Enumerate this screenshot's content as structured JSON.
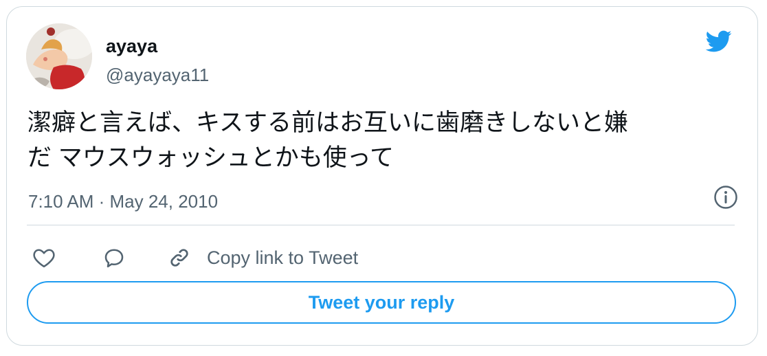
{
  "user": {
    "name": "ayaya",
    "handle": "@ayayaya11"
  },
  "tweet": {
    "text": "潔癖と言えば、キスする前はお互いに歯磨きしないと嫌\nだ マウスウォッシュとかも使って",
    "timestamp": "7:10 AM · May 24, 2010"
  },
  "actions": {
    "like_icon": "heart-icon",
    "reply_icon": "speech-bubble-icon",
    "copy_icon": "link-icon",
    "copy_label": "Copy link to Tweet"
  },
  "reply_button": {
    "label": "Tweet your reply"
  },
  "colors": {
    "accent": "#1d9bf0",
    "secondary_text": "#536471",
    "border": "#cfd9de"
  }
}
